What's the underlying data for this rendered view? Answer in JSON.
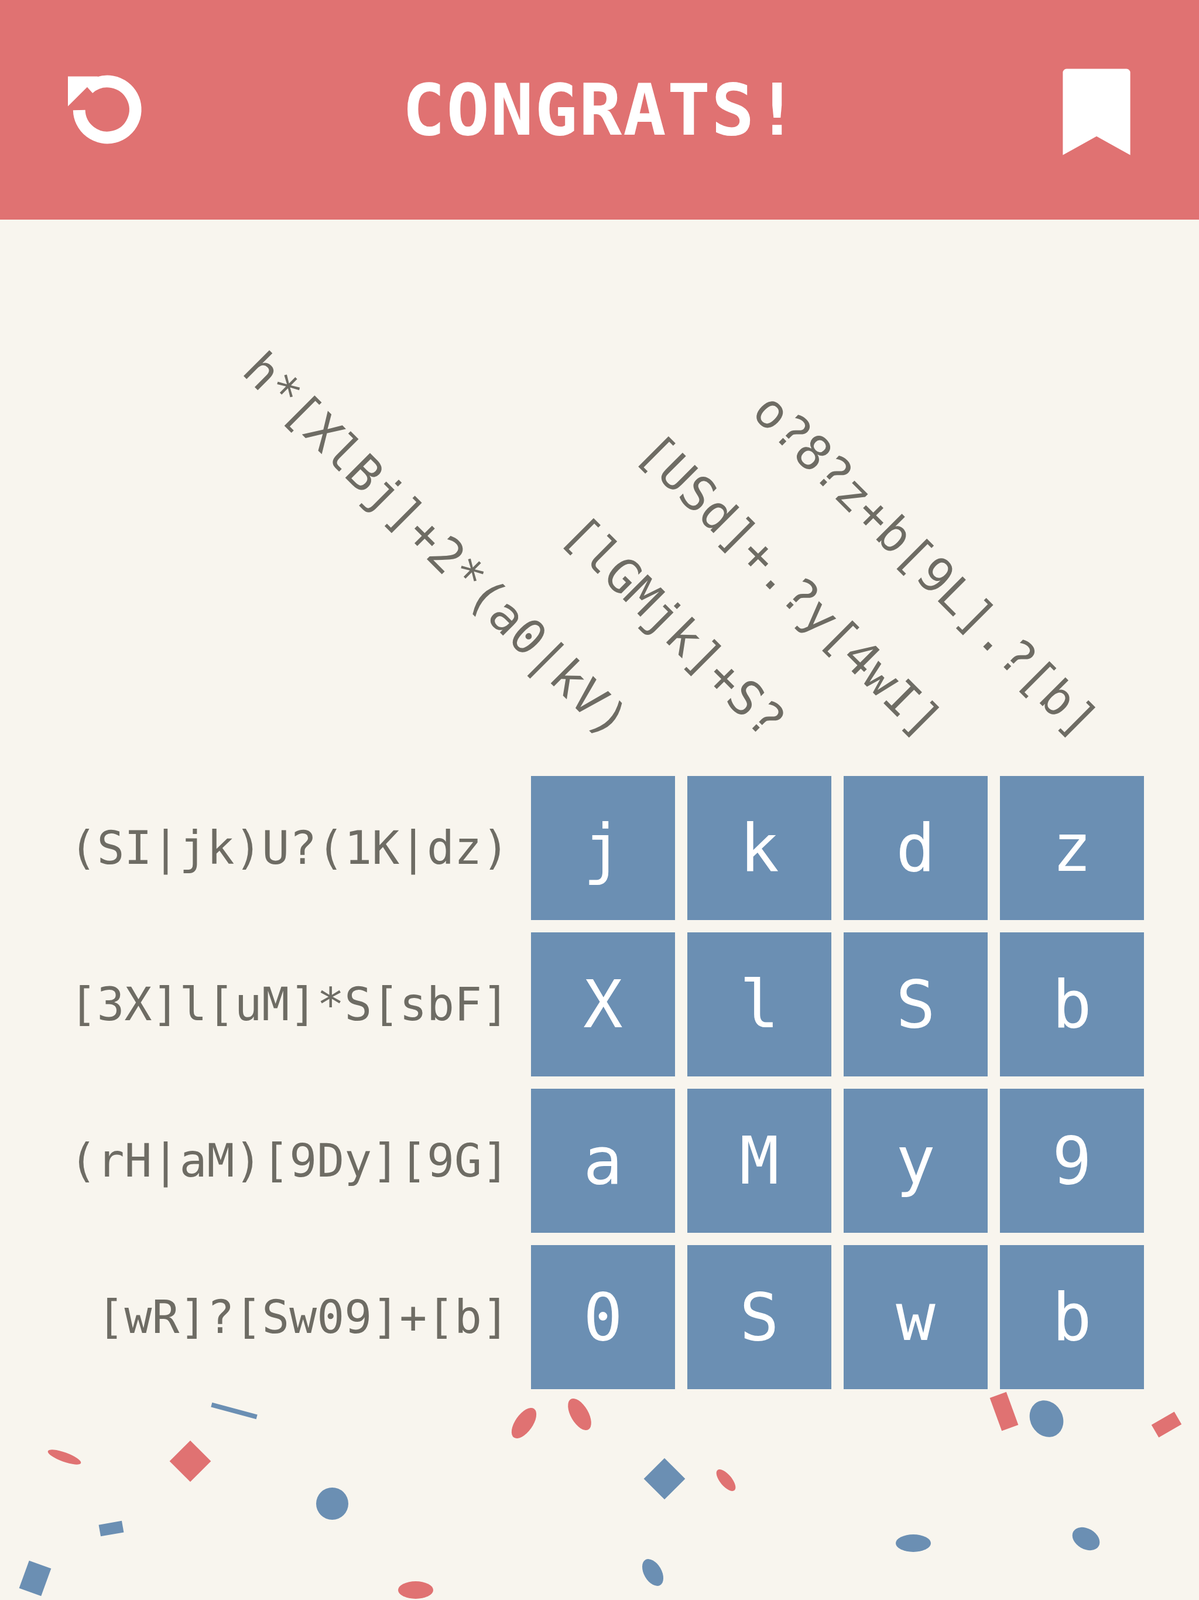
{
  "header": {
    "title": "CONGRATS!"
  },
  "puzzle": {
    "column_clues": [
      "h*[XlBj]+2*(a0|kV)",
      "[lGMjk]+S?",
      "[USd]+.?y[4wI]",
      "o?8?z+b[9L].?[b]"
    ],
    "row_clues": [
      "(SI|jk)U?(1K|dz)",
      "[3X]l[uM]*S[sbF]",
      "(rH|aM)[9Dy][9G]",
      "[wR]?[Sw09]+[b]"
    ],
    "cells": [
      [
        "j",
        "k",
        "d",
        "z"
      ],
      [
        "X",
        "l",
        "S",
        "b"
      ],
      [
        "a",
        "M",
        "y",
        "9"
      ],
      [
        "0",
        "S",
        "w",
        "b"
      ]
    ]
  }
}
